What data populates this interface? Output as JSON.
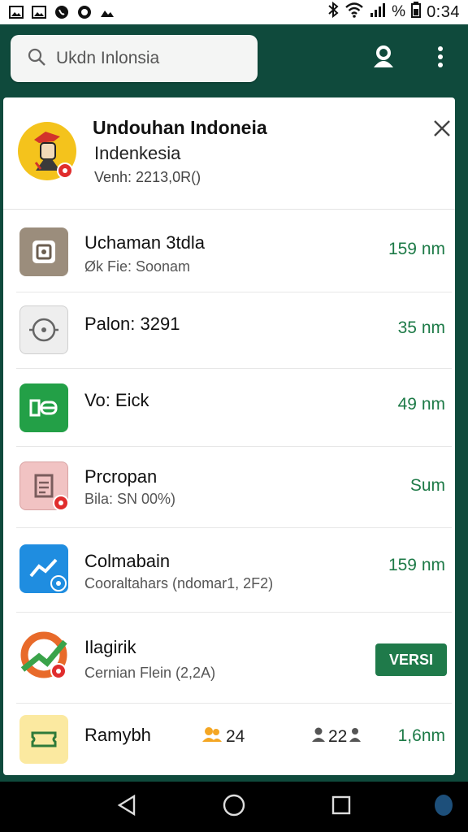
{
  "status_bar": {
    "left_icons": [
      "image-icon",
      "image-icon",
      "whatsapp-icon",
      "circle-icon",
      "photo-icon"
    ],
    "battery_text": "%",
    "time": "0:34"
  },
  "search": {
    "placeholder": "Ukdn Inlonsia"
  },
  "header": {
    "title": "Undouhan Indoneia",
    "subtitle": "Indenkesia",
    "version": "Venh: 2213,0R()"
  },
  "rows": [
    {
      "title": "Uchaman 3tdla",
      "subtitle": "Øk Fie: Soonam",
      "size": "159 nm",
      "icon": "camera-icon",
      "icon_color": "#9b8d7c"
    },
    {
      "title": "Palon: 3291",
      "subtitle": "",
      "size": "35 nm",
      "icon": "target-icon",
      "icon_color": "#eeeeee"
    },
    {
      "title": "Vo: Eick",
      "subtitle": "",
      "size": "49 nm",
      "icon": "battery-icon",
      "icon_color": "#23a047"
    },
    {
      "title": "Prcropan",
      "subtitle": "Bila:  SN 00%)",
      "size": "Sum",
      "icon": "document-icon",
      "icon_color": "#f1c3c3"
    },
    {
      "title": "Colmabain",
      "subtitle": "Cooraltahars (ndomar1, 2F2)",
      "size": "159 nm",
      "icon": "chart-icon",
      "icon_color": "#1f8de0"
    },
    {
      "title": "Ilagirik",
      "subtitle": "Cernian Flein (2,2A)",
      "action": "VERSI",
      "icon": "trend-icon",
      "icon_color": "#ffffff"
    },
    {
      "title": "Ramybh",
      "subtitle": "",
      "count_a": "24",
      "count_b": "22",
      "size": "1,6nm",
      "icon": "ticket-icon",
      "icon_color": "#fbe9a0"
    }
  ],
  "colors": {
    "appbar": "#0f4a3c",
    "accent_green": "#1d7a47",
    "badge_red": "#e02d2d"
  }
}
